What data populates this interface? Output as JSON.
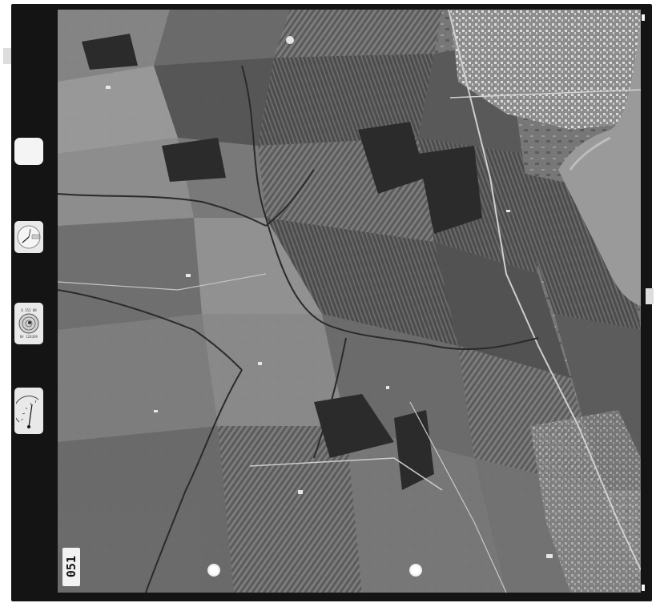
{
  "film": {
    "frame_number": "051"
  },
  "instruments": {
    "clock_icon": "clock-gauge-icon",
    "level_icon": "bubble-level-icon",
    "altimeter_icon": "altimeter-gauge-icon",
    "level_text_top": "6 152 88",
    "level_text_bottom": "Nr 124339"
  },
  "colors": {
    "frame": "#141414",
    "water": "#9a9a9a",
    "town": "#d9d9d9",
    "dark_field": "#2b2b2b"
  }
}
